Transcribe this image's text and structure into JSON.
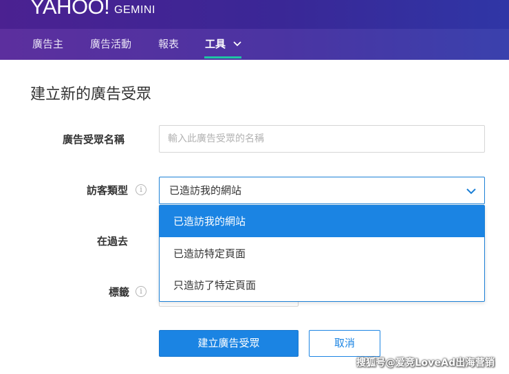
{
  "header": {
    "logo_text": "YAHOO!",
    "product_name": "GEMINI",
    "gradient_start": "#4b2191",
    "gradient_end": "#2f36a6"
  },
  "nav": {
    "items": [
      {
        "label": "廣告主"
      },
      {
        "label": "廣告活動"
      },
      {
        "label": "報表"
      },
      {
        "label": "工具",
        "active": true,
        "has_dropdown": true
      }
    ],
    "active_underline_color": "#1fc5a4"
  },
  "page": {
    "title": "建立新的廣告受眾"
  },
  "form": {
    "name": {
      "label": "廣告受眾名稱",
      "value": "",
      "placeholder": "輸入此廣告受眾的名稱"
    },
    "visitor_type": {
      "label": "訪客類型",
      "info_icon": "info-icon",
      "selected": "已造訪我的網站",
      "options": [
        {
          "label": "已造訪我的網站",
          "selected": true
        },
        {
          "label": "已造訪特定頁面",
          "selected": false
        },
        {
          "label": "只造訪了特定頁面",
          "selected": false
        }
      ]
    },
    "past": {
      "label": "在過去"
    },
    "tags": {
      "label": "標籤",
      "info_icon": "info-icon"
    }
  },
  "actions": {
    "create_label": "建立廣告受眾",
    "cancel_label": "取消",
    "accent_color": "#1b84e3"
  },
  "watermark": "搜狐号@爱竞LoveAd出海营销"
}
